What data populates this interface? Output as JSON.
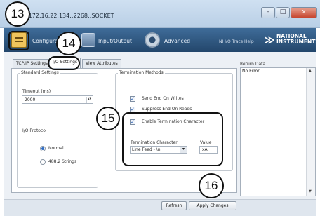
{
  "window": {
    "title": "TCPIP::172.16.22.134::2268::SOCKET",
    "title_visible": ":172.16.22.134::2268::SOCKET",
    "min": "–",
    "max": "□",
    "close": "x"
  },
  "toolbar": {
    "configuration": "Configuration",
    "configuration_visible": "Configure",
    "input_output": "Input/Output",
    "advanced": "Advanced",
    "ni_io_trace": "NI I/O Trace",
    "help": "Help",
    "logo_line1": "NATIONAL",
    "logo_line2": "INSTRUMENTS"
  },
  "tabs": [
    {
      "label": "TCP/IP Settings"
    },
    {
      "label": "I/O Settings"
    },
    {
      "label": "View Attributes"
    }
  ],
  "standard_settings": {
    "title": "Standard Settings",
    "timeout_label": "Timeout (ms)",
    "timeout_value": "2000",
    "io_protocol_label": "I/O Protocol",
    "protocol_options": [
      "Normal",
      "488.2 Strings"
    ],
    "protocol_selected": "Normal"
  },
  "termination": {
    "title": "Termination Methods",
    "send_end_on_writes": "Send End On Writes",
    "suppress_end_on_reads": "Suppress End On Reads",
    "enable_termination_char": "Enable Termination Character",
    "termination_char_label": "Termination Character",
    "termination_char_value": "Line Feed - \\n",
    "value_label": "Value",
    "value_value": "xA"
  },
  "return_data": {
    "label": "Return Data",
    "text": "No Error"
  },
  "buttons": {
    "refresh": "Refresh",
    "apply": "Apply Changes"
  },
  "callouts": {
    "c13": "13",
    "c14": "14",
    "c15": "15",
    "c16": "16"
  },
  "colors": {
    "toolbar": "#2f5a85",
    "accent": "#2d6bc4"
  }
}
